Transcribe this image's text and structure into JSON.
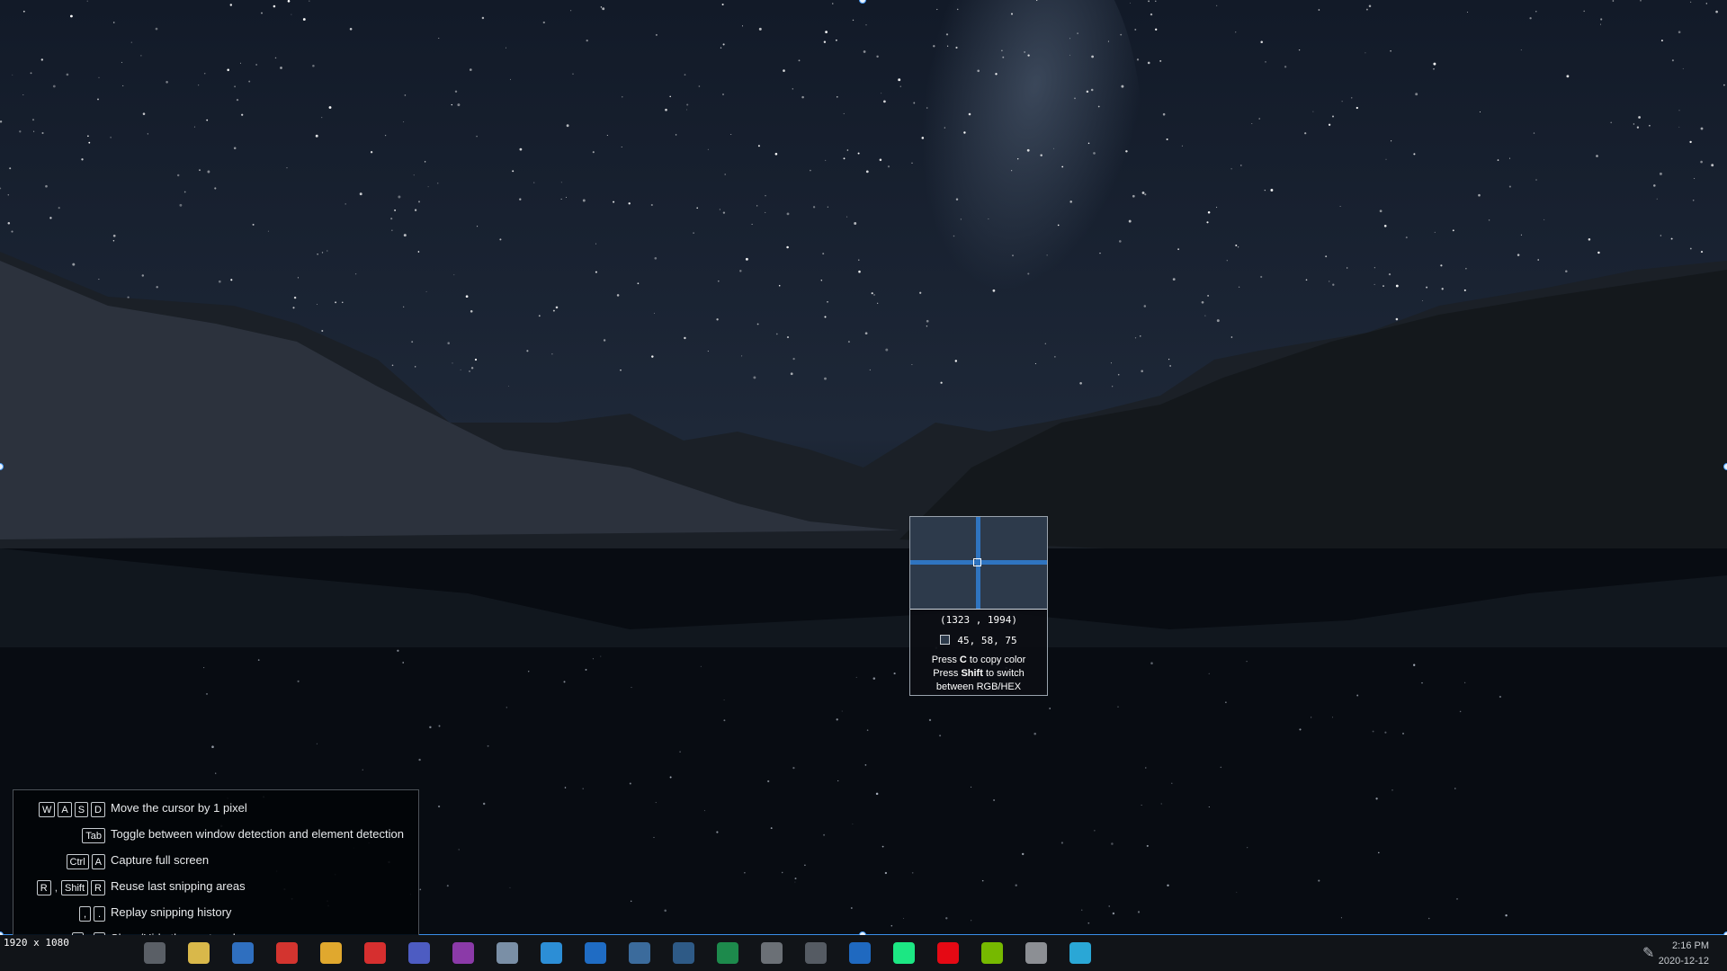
{
  "magnifier": {
    "coords": "(1323 , 1994)",
    "rgb": "45,  58,  75",
    "sample_color": "#2d3a4b",
    "hint_press": "Press",
    "hint_c": "C",
    "hint_copy": "to copy color",
    "hint_shift": "Shift",
    "hint_switch": "to switch",
    "hint_between": "between RGB/HEX"
  },
  "shortcuts": [
    {
      "keys": [
        "W",
        "A",
        "S",
        "D"
      ],
      "label": "Move the cursor by 1 pixel"
    },
    {
      "keys": [
        "Tab"
      ],
      "label": "Toggle between window detection and element detection"
    },
    {
      "keys": [
        "Ctrl",
        "A"
      ],
      "label": "Capture full screen"
    },
    {
      "keys": [
        "R",
        ",",
        "Shift",
        "R"
      ],
      "label": "Reuse last snipping areas"
    },
    {
      "keys": [
        ",",
        "."
      ],
      "label": "Replay snipping history"
    },
    {
      "keys": [
        "`",
        "/",
        "!"
      ],
      "label": "Show/Hide the captured mouse cursor"
    }
  ],
  "size_indicator": "1920 x 1080",
  "taskbar": {
    "time": "2:16 PM",
    "date": "2020-12-12",
    "apps": [
      {
        "icon": "file-explorer-icon",
        "color": "#5a5f66"
      },
      {
        "icon": "folder-icon",
        "color": "#d9b84a"
      },
      {
        "icon": "mail-icon",
        "color": "#2f6fbf"
      },
      {
        "icon": "opera-icon",
        "color": "#d3342f"
      },
      {
        "icon": "chrome-icon",
        "color": "#e0a82e"
      },
      {
        "icon": "netease-music-icon",
        "color": "#d62f2f"
      },
      {
        "icon": "teams-icon",
        "color": "#4d5cc2"
      },
      {
        "icon": "onenote-icon",
        "color": "#8b3aa8"
      },
      {
        "icon": "pen-app-icon",
        "color": "#7a8fa6"
      },
      {
        "icon": "calendar-icon",
        "color": "#2c8ed6"
      },
      {
        "icon": "outlook-icon",
        "color": "#1f6cc4"
      },
      {
        "icon": "steam-icon",
        "color": "#3b6b9c"
      },
      {
        "icon": "steam-alt-icon",
        "color": "#2e5a86"
      },
      {
        "icon": "excel-green-icon",
        "color": "#1d8a4c"
      },
      {
        "icon": "facebook-icon",
        "color": "#6b7076"
      },
      {
        "icon": "calculator-icon",
        "color": "#555b63"
      },
      {
        "icon": "wave-app-icon",
        "color": "#1f69c0"
      },
      {
        "icon": "hulu-icon",
        "color": "#1ce783"
      },
      {
        "icon": "netflix-icon",
        "color": "#e50914"
      },
      {
        "icon": "nvidia-icon",
        "color": "#76b900"
      },
      {
        "icon": "disk-icon",
        "color": "#8c8f94"
      },
      {
        "icon": "edge-icon",
        "color": "#2aa7d6"
      }
    ]
  }
}
